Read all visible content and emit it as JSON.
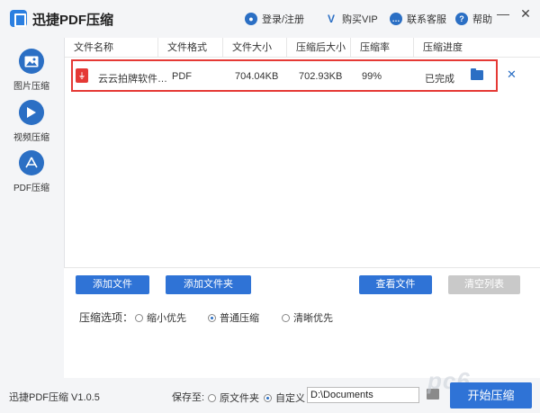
{
  "app": {
    "title": "迅捷PDF压缩"
  },
  "header": {
    "login": "登录/注册",
    "buy_vip": "购买VIP",
    "support": "联系客服",
    "help": "帮助"
  },
  "window_controls": {
    "minimize": "—",
    "close": "✕"
  },
  "sidebar": {
    "items": [
      {
        "label": "图片压缩",
        "icon": "image-icon"
      },
      {
        "label": "视频压缩",
        "icon": "play-icon"
      },
      {
        "label": "PDF压缩",
        "icon": "pdf-icon"
      }
    ]
  },
  "table": {
    "headers": [
      "文件名称",
      "文件格式",
      "文件大小",
      "压缩后大小",
      "压缩率",
      "压缩进度"
    ],
    "rows": [
      {
        "name": "云云拍牌软件…",
        "format": "PDF",
        "size": "704.04KB",
        "compressed_size": "702.93KB",
        "ratio": "99%",
        "progress": "已完成"
      }
    ]
  },
  "buttons": {
    "add_file": "添加文件",
    "add_folder": "添加文件夹",
    "view_files": "查看文件",
    "clear_list": "清空列表",
    "start": "开始压缩"
  },
  "options": {
    "label": "压缩选项：",
    "choices": [
      "缩小优先",
      "普通压缩",
      "清晰优先"
    ],
    "selected": "普通压缩"
  },
  "footer": {
    "version": "迅捷PDF压缩 V1.0.5",
    "save_label": "保存至:",
    "save_choices": [
      "原文件夹",
      "自定义"
    ],
    "save_selected": "自定义",
    "path": "D:\\Documents",
    "watermark": "pc6"
  },
  "colors": {
    "accent": "#2f73d6",
    "highlight_border": "#e53935",
    "disabled": "#c9c9c9"
  }
}
